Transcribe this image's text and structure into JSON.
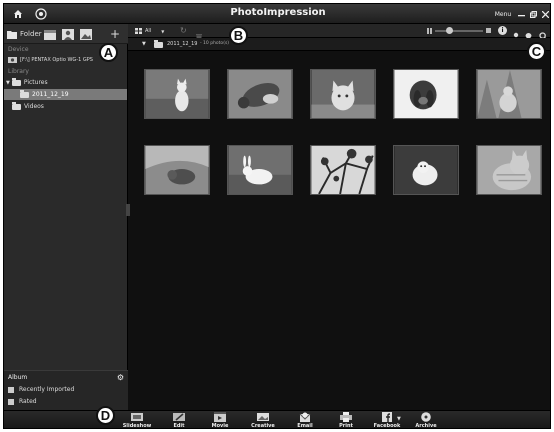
{
  "window": {
    "title": "PhotoImpression",
    "menu_label": "Menu"
  },
  "sidebar": {
    "toolbar": {
      "folder_label": "Folder"
    },
    "device_header": "Device",
    "device_item": "[F:\\] PENTAX Optio WG-1 GPS",
    "library_header": "Library",
    "tree": [
      {
        "label": "Pictures",
        "level": 0
      },
      {
        "label": "2011_12_19",
        "level": 1,
        "selected": true
      },
      {
        "label": "Videos",
        "level": 0
      }
    ],
    "album": {
      "header": "Album",
      "items": [
        "Recently Imported",
        "Rated"
      ]
    }
  },
  "main": {
    "view_label": "All",
    "breadcrumb": {
      "folder": "2011_12_19",
      "count": "- 10 photo(s)"
    },
    "photos": [
      {
        "subject": "cat sitting"
      },
      {
        "subject": "cat lying"
      },
      {
        "subject": "cat face"
      },
      {
        "subject": "dog"
      },
      {
        "subject": "cat on grass"
      },
      {
        "subject": "cat under cloth"
      },
      {
        "subject": "rabbit"
      },
      {
        "subject": "tree branches"
      },
      {
        "subject": "small dog"
      },
      {
        "subject": "tabby cat"
      }
    ]
  },
  "bottombar": {
    "actions": [
      "Slideshow",
      "Edit",
      "Movie",
      "Creative",
      "Email",
      "Print",
      "Facebook",
      "Archive"
    ]
  },
  "callouts": [
    "A",
    "B",
    "C",
    "D"
  ]
}
